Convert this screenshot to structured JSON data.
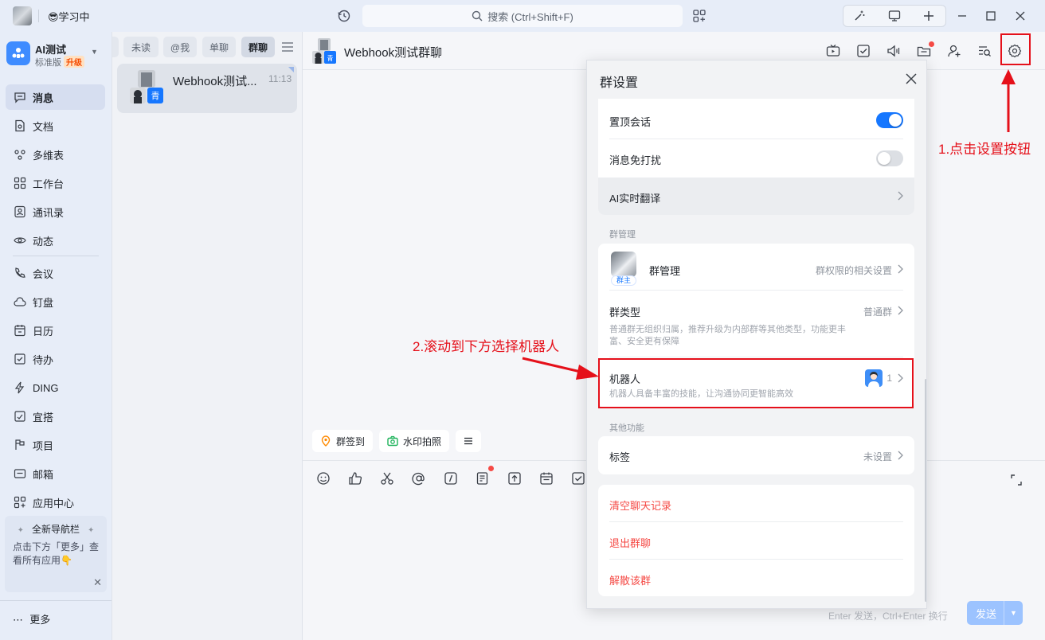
{
  "titlebar": {
    "status_label": "😎学习中",
    "search_placeholder": "搜索 (Ctrl+Shift+F)"
  },
  "org": {
    "name": "AI测试",
    "version": "标准版",
    "upgrade": "升级"
  },
  "nav": {
    "items": [
      {
        "label": "消息",
        "icon": "message-icon"
      },
      {
        "label": "文档",
        "icon": "document-icon"
      },
      {
        "label": "多维表",
        "icon": "table-icon"
      },
      {
        "label": "工作台",
        "icon": "grid-icon"
      },
      {
        "label": "通讯录",
        "icon": "contacts-icon"
      },
      {
        "label": "动态",
        "icon": "eye-icon"
      },
      {
        "label": "会议",
        "icon": "phone-icon"
      },
      {
        "label": "钉盘",
        "icon": "cloud-icon"
      },
      {
        "label": "日历",
        "icon": "calendar-icon"
      },
      {
        "label": "待办",
        "icon": "checkbox-icon"
      },
      {
        "label": "DING",
        "icon": "bolt-icon"
      },
      {
        "label": "宜搭",
        "icon": "build-icon"
      },
      {
        "label": "项目",
        "icon": "project-icon"
      },
      {
        "label": "邮箱",
        "icon": "mail-icon"
      },
      {
        "label": "应用中心",
        "icon": "apps-icon"
      }
    ],
    "tip_title": "全新导航栏",
    "tip_body": "点击下方「更多」查看所有应用👇",
    "more": "更多"
  },
  "conv_list": {
    "filters": [
      "未读",
      "@我",
      "单聊",
      "群聊"
    ],
    "active_filter": "群聊",
    "conversations": [
      {
        "name": "Webhook测试...",
        "time": "11:13",
        "badge": "青"
      }
    ]
  },
  "chat": {
    "title": "Webhook测试群聊",
    "badge": "青",
    "quick_actions": [
      "群签到",
      "水印拍照"
    ],
    "send_hint": "Enter 发送，Ctrl+Enter 换行",
    "send_label": "发送"
  },
  "settings": {
    "title": "群设置",
    "pin_label": "置顶会话",
    "pin_on": true,
    "mute_label": "消息免打扰",
    "mute_on": false,
    "translate_label": "AI实时翻译",
    "section_manage": "群管理",
    "manage_label": "群管理",
    "manage_value": "群权限的相关设置",
    "owner_tag": "群主",
    "type_label": "群类型",
    "type_value": "普通群",
    "type_desc_1": "普通群无组织归属，推荐升级为内部群等其他类型，功能更丰",
    "type_desc_2": "富、安全更有保障",
    "robot_label": "机器人",
    "robot_count": "1",
    "robot_desc": "机器人具备丰富的技能，让沟通协同更智能高效",
    "section_other": "其他功能",
    "tag_label": "标签",
    "tag_value": "未设置",
    "clear_label": "清空聊天记录",
    "leave_label": "退出群聊",
    "dissolve_label": "解散该群"
  },
  "annotations": {
    "step1": "1.点击设置按钮",
    "step2": "2.滚动到下方选择机器人",
    "color": "#e5101a"
  },
  "colors": {
    "accent": "#1677ff",
    "danger": "#f54a45"
  }
}
